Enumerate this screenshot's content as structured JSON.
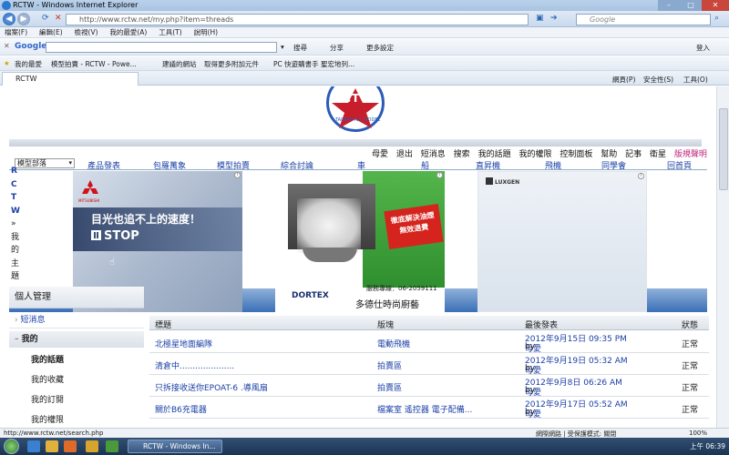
{
  "window": {
    "title": "RCTW - Windows Internet Explorer"
  },
  "address_bar": {
    "url": "http://www.rctw.net/my.php?item=threads"
  },
  "search_box": {
    "placeholder": "Google"
  },
  "menu": [
    "檔案(F)",
    "編輯(E)",
    "檢視(V)",
    "我的最愛(A)",
    "工具(T)",
    "說明(H)"
  ],
  "google_toolbar": {
    "logo": "Google",
    "search_label": "搜尋",
    "share_label": "分享",
    "more_label": "更多設定",
    "login_label": "登入"
  },
  "favorites_bar": {
    "favorites": "我的最愛",
    "item1": "模型拍賣 - RCTW - Powe...",
    "item2": "建議的網站",
    "item3": "取得更多附加元件",
    "item4": "PC 快遊購書手 聖宏地列..."
  },
  "tab": {
    "label": "RCTW"
  },
  "tab_tools": {
    "page": "網頁(P)",
    "safety": "安全性(S)",
    "tools": "工具(O)"
  },
  "site": {
    "logo_text": "RCTW",
    "logo_sub": "TAIWAN R/C MODEL",
    "nav": [
      "母愛",
      "退出",
      "短消息",
      "搜索",
      "我的話題",
      "我的權限",
      "控制面板",
      "幫助",
      "記事",
      "衛星"
    ],
    "nav_highlight": "版規聲明",
    "category_select": "模型部落",
    "categories": [
      "產品發表",
      "包羅萬象",
      "模型拍賣",
      "綜合討論",
      "車",
      "船",
      "直昇機",
      "飛機",
      "同學會",
      "回首頁"
    ],
    "side_vertical": [
      "R",
      "C",
      "T",
      "W",
      "»",
      "我",
      "的",
      "主",
      "題"
    ]
  },
  "ads": {
    "ad1_line1": "目光也追不上的速度！",
    "ad1_line2": "STOP",
    "ad1_brand": "MITSUBISHI",
    "ad2_stamp": "徹底解決油煙 無效退費",
    "ad2_brand": "DORTEX",
    "ad2_phone": "服務專線：06-2059111",
    "ad2_shop": "多德仕時尚廚藝",
    "ad3_brand": "LUXGEN"
  },
  "sidebar": {
    "title": "個人管理",
    "item_pm": "短消息",
    "item_mine": "我的",
    "subitems": [
      "我的話題",
      "我的收藏",
      "我的訂閱",
      "我的權限"
    ]
  },
  "table": {
    "headers": [
      "標題",
      "版塊",
      "最後發表",
      "狀態"
    ],
    "rows": [
      {
        "title": "北極星地面編隊",
        "forum": "電動飛機",
        "date": "2012年9月15日 09:35 PM",
        "by": "by",
        "user": "母愛",
        "status": "正常"
      },
      {
        "title": "清倉中.....................",
        "forum": "拍賣區",
        "date": "2012年9月19日 05:32 AM",
        "by": "by",
        "user": "母愛",
        "status": "正常"
      },
      {
        "title": "只拆接收送你EPOAT-6 .導風扇",
        "forum": "拍賣區",
        "date": "2012年9月8日 06:26 AM",
        "by": "by",
        "user": "母愛",
        "status": "正常"
      },
      {
        "title": "關於B6充電器",
        "forum": "檔案室 遙控器 電子配備...",
        "date": "2012年9月17日 05:52 AM",
        "by": "by",
        "user": "母愛",
        "status": "正常"
      }
    ]
  },
  "status_bar": {
    "url": "http://www.rctw.net/search.php",
    "zone": "網際網路 | 受保護模式: 關閉",
    "zoom": "100%"
  },
  "taskbar": {
    "task": "RCTW - Windows In...",
    "clock": "上午 06:39"
  }
}
